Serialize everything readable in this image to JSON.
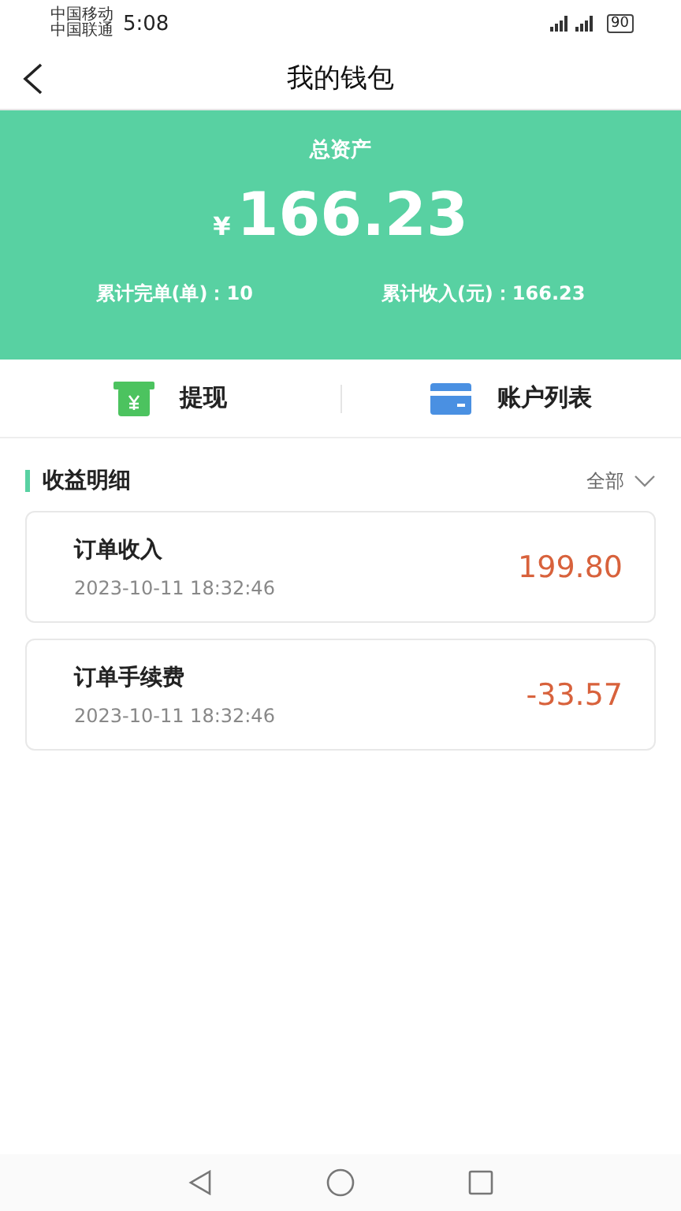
{
  "status_bar": {
    "carriers": [
      "中国移动",
      "中国联通"
    ],
    "time": "5:08",
    "battery": "90"
  },
  "header": {
    "title": "我的钱包"
  },
  "summary": {
    "label": "总资产",
    "currency": "¥",
    "amount": "166.23",
    "stats": [
      {
        "label": "累计完单(单)：10"
      },
      {
        "label": "累计收入(元)：166.23"
      }
    ]
  },
  "actions": [
    {
      "kind": "withdraw",
      "label": "提现"
    },
    {
      "kind": "accounts",
      "label": "账户列表"
    }
  ],
  "section": {
    "title": "收益明细",
    "filter": "全部"
  },
  "records": [
    {
      "title": "订单收入",
      "time": "2023-10-11 18:32:46",
      "amount": "199.80"
    },
    {
      "title": "订单手续费",
      "time": "2023-10-11 18:32:46",
      "amount": "-33.57"
    }
  ]
}
